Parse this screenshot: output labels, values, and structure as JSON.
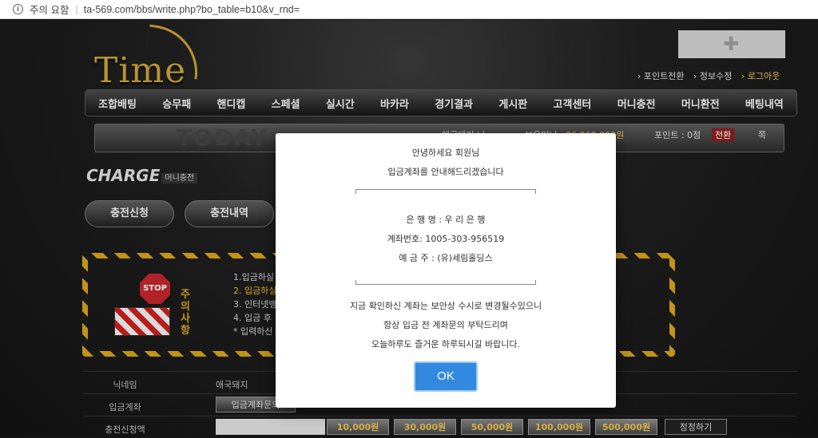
{
  "browser": {
    "security_label": "주의 요함",
    "url": "ta-569.com/bbs/write.php?bo_table=b10&v_rnd="
  },
  "site": {
    "logo_text": "Time",
    "top_links": [
      "포인트전환",
      "정보수정",
      "로그아웃"
    ],
    "menu": [
      "조합배팅",
      "승무패",
      "핸디캡",
      "스페셜",
      "실시간",
      "바카라",
      "경기결과",
      "게시판",
      "고객센터",
      "머니충전",
      "머니환전",
      "베팅내역"
    ],
    "info_bar": {
      "today_text": "TODAY",
      "nickname": "애국돼지 님",
      "money_label": "보유머니 :",
      "money_value": "26,268,000원",
      "point_label": "포인트 : 0점",
      "point_button": "전환",
      "msg_label": "쪽"
    },
    "section_title": "CHARGE",
    "section_sub": "머니충전",
    "buttons": [
      "충전신청",
      "충전내역"
    ],
    "notice_title": "주의사항",
    "stop_text": "STOP",
    "notice_lines": [
      "1.입금하실",
      "2. 입금하실",
      "3. 인터넷뱅",
      "4. 입금 후",
      "* 입력하신"
    ],
    "form": {
      "rows": [
        {
          "label": "닉네임",
          "value": "애국돼지"
        },
        {
          "label": "입금계좌",
          "value": "입금계좌문의"
        },
        {
          "label": "충전신청액",
          "value": ""
        }
      ],
      "amounts": [
        "10,000원",
        "30,000원",
        "50,000원",
        "100,000원",
        "500,000원"
      ],
      "reset_label": "정정하기"
    }
  },
  "modal": {
    "greeting": "안녕하세요 회원님",
    "intro": "입금계좌를 안내해드리겠습니다",
    "bank": "은 행 명 : 우 리 은 행",
    "account": "계좌번호: 1005-303-956519",
    "holder": "예 금 주 : (유)세림홀딩스",
    "warn1": "지금 확인하신 계좌는 보안상 수시로 변경될수있으니",
    "warn2": "항상 입금 전 계좌문의 부탁드리며",
    "warn3": "오늘하루도 즐거운 하루되시길 바랍니다.",
    "ok_label": "OK"
  }
}
